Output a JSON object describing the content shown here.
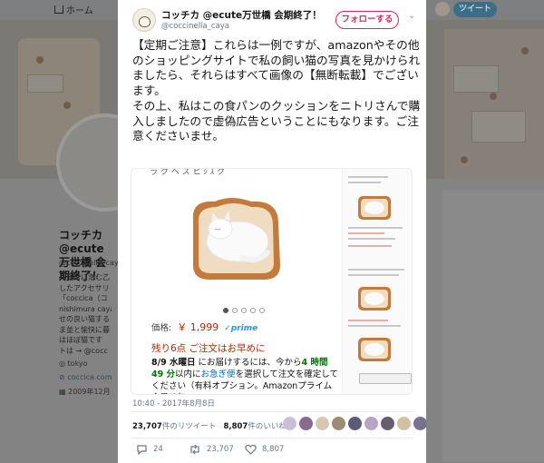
{
  "background": {
    "nav_home_label": "ホーム",
    "tweet_button_label": "ツイート",
    "profile_name": "コッチカ @ecute万世橋 会期終了！",
    "profile_handle": "@coccinella_caya",
    "bio_lines": [
      "「日常に潜む乙",
      "したアクセサリ",
      "「coccica（コ",
      "nishimura caya",
      "せの良い猫する",
      "ま並と愉快に暮",
      "はほぼ猫です",
      "トは → @cocc"
    ],
    "location": "tokyo",
    "website": "coccica.com",
    "joined": "2009年12月"
  },
  "tweet": {
    "display_name": "コッチカ @ecute万世橋 会期終了！",
    "handle": "@coccinella_caya",
    "follow_label": "フォローする",
    "text": "【定期ご注意】これらは一例ですが、amazonやその他のショッピングサイトで私の飼い猫の写真を見かけられましたら、それらはすべて画像の【無断転載】でございます。\nその上、私はこの食パンのクッションをニトリさんで購入しましたので虚偽広告ということにもなります。ご注意くださいませ。",
    "timestamp": "10:40 - 2017年8月8日",
    "retweets": "23,707",
    "retweets_label": "件のリツイート",
    "likes": "8,807",
    "likes_label": "件のいいね",
    "reply_count": "24",
    "retweet_count": "23,707",
    "like_count": "8,807"
  },
  "embedded_image": {
    "price_label": "価格:",
    "price": "￥ 1,999",
    "prime_label": "prime",
    "stock_warning": "残り6点 ご注文はお早めに",
    "delivery_date": "8/9 水曜日",
    "delivery_mid": "にお届けするには、今から",
    "delivery_time": "4 時間 49 分",
    "delivery_mid2": "以内に",
    "delivery_link": "お急ぎ便",
    "delivery_tail": "を選択して注文を確定してください（有料オプション。Amazonプライム会員は無"
  },
  "colors": {
    "follow_accent": "#e0245e",
    "link_blue": "#0066c0",
    "price_red": "#b12704",
    "delivery_green": "#007600",
    "prime_blue": "#1a98ff"
  },
  "icons": [
    "home-icon",
    "chevron-down-icon",
    "reply-icon",
    "retweet-icon",
    "like-icon",
    "location-icon",
    "link-icon",
    "calendar-icon"
  ]
}
